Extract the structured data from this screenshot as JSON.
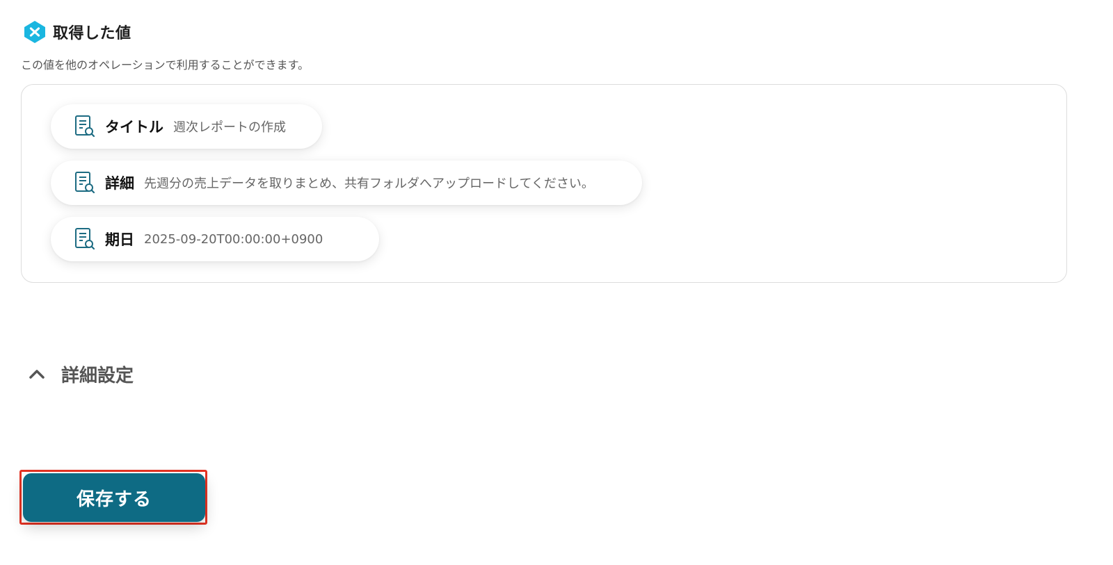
{
  "section": {
    "title": "取得した値",
    "description": "この値を他のオペレーションで利用することができます。",
    "brand_icon": "yoom-logo-icon",
    "brand_color": "#1ab6e0"
  },
  "values": [
    {
      "label": "タイトル",
      "value": "週次レポートの作成",
      "icon": "document-search-icon"
    },
    {
      "label": "詳細",
      "value": "先週分の売上データを取りまとめ、共有フォルダへアップロードしてください。",
      "icon": "document-search-icon"
    },
    {
      "label": "期日",
      "value": "2025-09-20T00:00:00+0900",
      "icon": "document-search-icon"
    }
  ],
  "advanced": {
    "label": "詳細設定",
    "icon": "chevron-up-icon"
  },
  "save": {
    "label": "保存する",
    "color": "#0e6b84",
    "highlight_color": "#e53323"
  }
}
